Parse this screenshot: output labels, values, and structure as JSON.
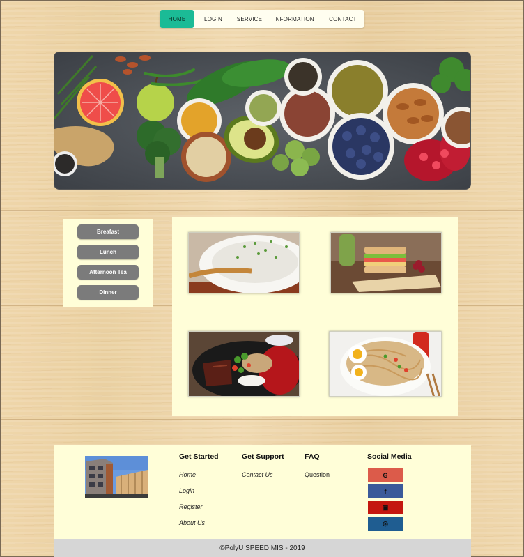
{
  "nav": {
    "items": [
      {
        "label": "HOME",
        "active": true
      },
      {
        "label": "LOGIN",
        "active": false
      },
      {
        "label": "SERVICE",
        "active": false
      },
      {
        "label": "INFORMATION",
        "active": false
      },
      {
        "label": "CONTACT",
        "active": false
      }
    ]
  },
  "side_menu": {
    "items": [
      "Breafast",
      "Lunch",
      "Afternoon Tea",
      "Dinner"
    ]
  },
  "footer": {
    "get_started": {
      "title": "Get Started",
      "links": [
        "Home",
        "Login",
        "Register",
        "About Us"
      ]
    },
    "get_support": {
      "title": "Get Support",
      "links": [
        "Contact Us"
      ]
    },
    "faq": {
      "title": "FAQ",
      "links": [
        "Question"
      ]
    },
    "social": {
      "title": "Social Media",
      "items": [
        {
          "icon": "google-icon",
          "glyph": "G",
          "color": "#dc5b4a"
        },
        {
          "icon": "facebook-icon",
          "glyph": "f",
          "color": "#3b5a9a"
        },
        {
          "icon": "youtube-icon",
          "glyph": "▣",
          "color": "#c4170f"
        },
        {
          "icon": "instagram-icon",
          "glyph": "◎",
          "color": "#1f5d91"
        }
      ]
    },
    "copyright": "©PolyU SPEED MIS - 2019"
  },
  "colors": {
    "accent": "#1bbb96",
    "panel": "#fffed8",
    "button": "#7b7b7b"
  }
}
